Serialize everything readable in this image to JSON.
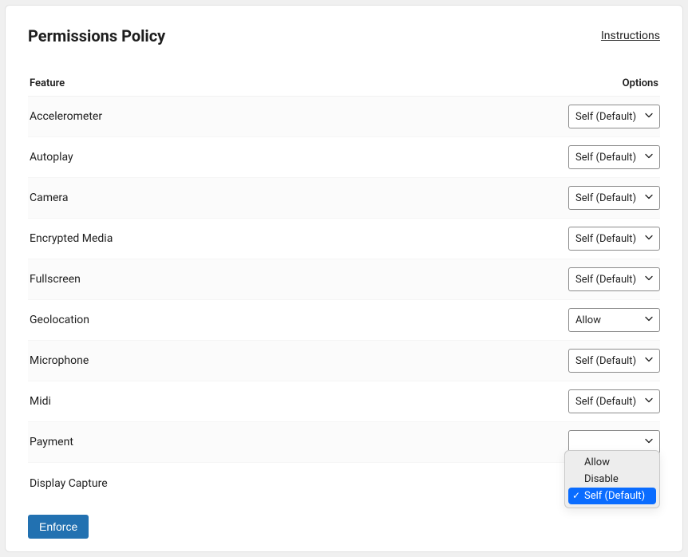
{
  "header": {
    "title": "Permissions Policy",
    "instructions": "Instructions"
  },
  "table": {
    "feature_header": "Feature",
    "options_header": "Options"
  },
  "rows": [
    {
      "feature": "Accelerometer",
      "value": "Self (Default)"
    },
    {
      "feature": "Autoplay",
      "value": "Self (Default)"
    },
    {
      "feature": "Camera",
      "value": "Self (Default)"
    },
    {
      "feature": "Encrypted Media",
      "value": "Self (Default)"
    },
    {
      "feature": "Fullscreen",
      "value": "Self (Default)"
    },
    {
      "feature": "Geolocation",
      "value": "Allow"
    },
    {
      "feature": "Microphone",
      "value": "Self (Default)"
    },
    {
      "feature": "Midi",
      "value": "Self (Default)"
    },
    {
      "feature": "Payment",
      "value": ""
    },
    {
      "feature": "Display Capture",
      "value": ""
    }
  ],
  "dropdown": {
    "options": [
      {
        "label": "Allow",
        "selected": false
      },
      {
        "label": "Disable",
        "selected": false
      },
      {
        "label": "Self (Default)",
        "selected": true
      }
    ]
  },
  "actions": {
    "enforce": "Enforce"
  }
}
